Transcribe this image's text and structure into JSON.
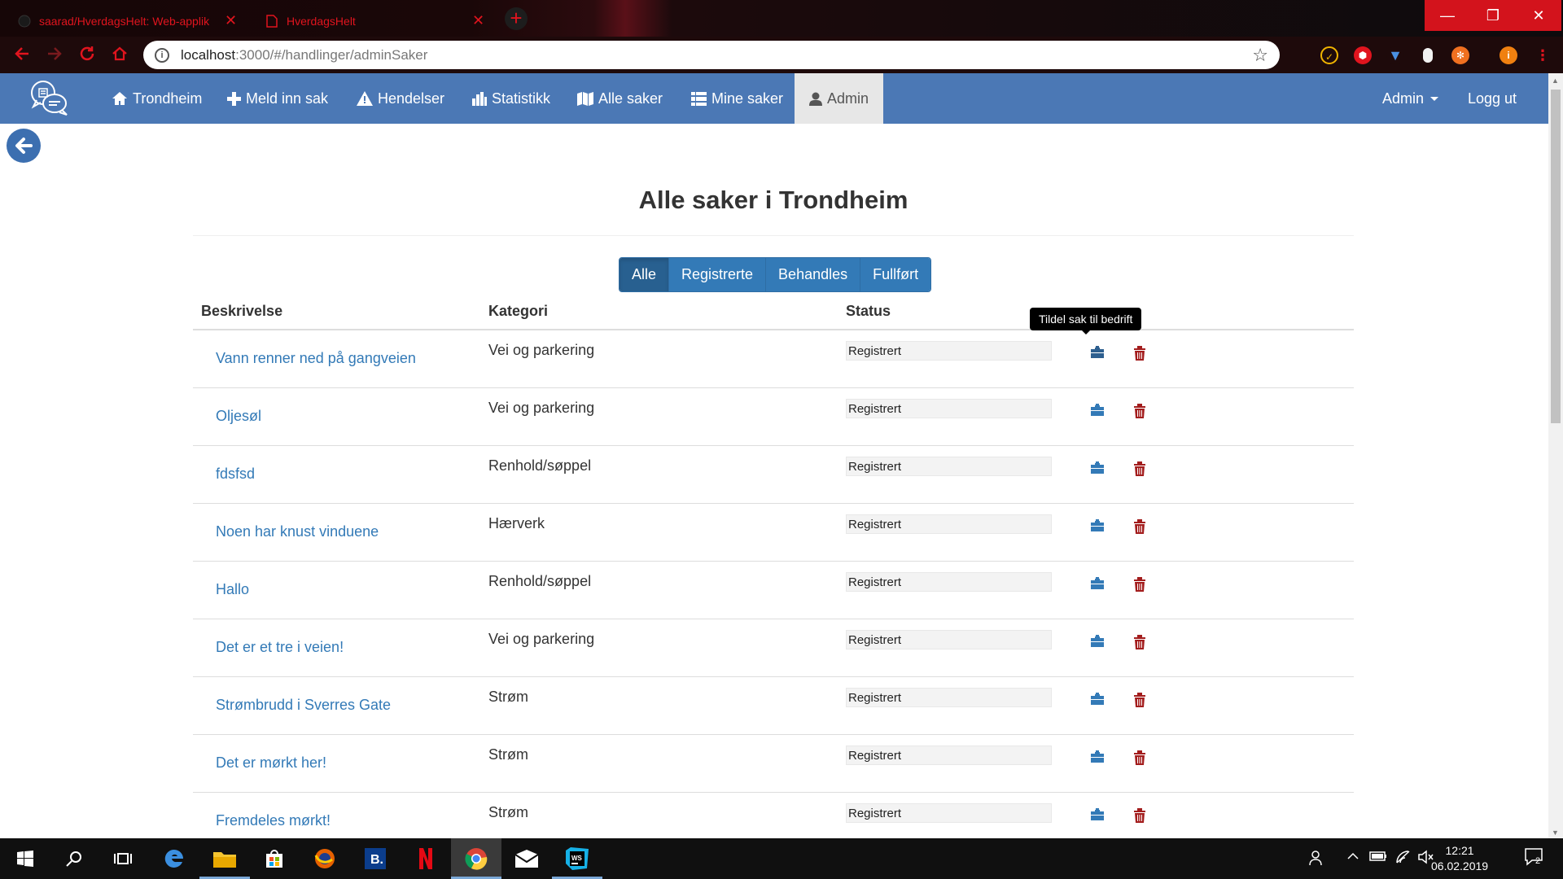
{
  "browser": {
    "tabs": [
      {
        "title": "saarad/HverdagsHelt: Web-applik",
        "close": "✕"
      },
      {
        "title": "HverdagsHelt",
        "close": "✕"
      }
    ],
    "new_tab": "+",
    "url_host": "localhost",
    "url_path": ":3000/#/handlinger/adminSaker",
    "window_buttons": {
      "minimize": "—",
      "restore": "❐",
      "close": "✕"
    }
  },
  "navbar": {
    "items": [
      {
        "label": "Trondheim",
        "icon": "home-icon"
      },
      {
        "label": "Meld inn sak",
        "icon": "plus-icon"
      },
      {
        "label": "Hendelser",
        "icon": "warning-icon"
      },
      {
        "label": "Statistikk",
        "icon": "bar-chart-icon"
      },
      {
        "label": "Alle saker",
        "icon": "map-icon"
      },
      {
        "label": "Mine saker",
        "icon": "list-icon"
      },
      {
        "label": "Admin",
        "icon": "user-icon"
      }
    ],
    "user_dropdown": "Admin",
    "logout": "Logg ut"
  },
  "page": {
    "title": "Alle saker i Trondheim",
    "filters": [
      {
        "label": "Alle",
        "active": true
      },
      {
        "label": "Registrerte",
        "active": false
      },
      {
        "label": "Behandles",
        "active": false
      },
      {
        "label": "Fullført",
        "active": false
      }
    ],
    "table": {
      "headers": [
        "Beskrivelse",
        "Kategori",
        "Status"
      ],
      "rows": [
        {
          "description": "Vann renner ned på gangveien",
          "category": "Vei og parkering",
          "status": "Registrert"
        },
        {
          "description": "Oljesøl",
          "category": "Vei og parkering",
          "status": "Registrert"
        },
        {
          "description": "fdsfsd",
          "category": "Renhold/søppel",
          "status": "Registrert"
        },
        {
          "description": "Noen har knust vinduene",
          "category": "Hærverk",
          "status": "Registrert"
        },
        {
          "description": "Hallo",
          "category": "Renhold/søppel",
          "status": "Registrert"
        },
        {
          "description": "Det er et tre i veien!",
          "category": "Vei og parkering",
          "status": "Registrert"
        },
        {
          "description": "Strømbrudd i Sverres Gate",
          "category": "Strøm",
          "status": "Registrert"
        },
        {
          "description": "Det er mørkt her!",
          "category": "Strøm",
          "status": "Registrert"
        },
        {
          "description": "Fremdeles mørkt!",
          "category": "Strøm",
          "status": "Registrert"
        }
      ]
    },
    "tooltip": "Tildel sak til bedrift"
  },
  "taskbar": {
    "time": "12:21",
    "date": "06.02.2019",
    "notifications": "2"
  },
  "colors": {
    "navbar": "#4b78b5",
    "link": "#337ab7",
    "button": "#337ab7",
    "button_active": "#286090",
    "trash": "#a31d1d",
    "browser_accent": "#e0141e"
  }
}
